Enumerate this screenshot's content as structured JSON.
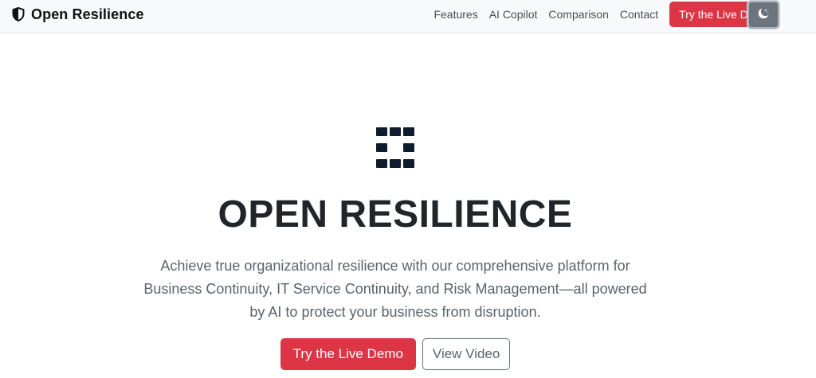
{
  "navbar": {
    "brand_icon": "shield-half-icon",
    "brand": "Open Resilience",
    "links": [
      {
        "label": "Features"
      },
      {
        "label": "AI Copilot"
      },
      {
        "label": "Comparison"
      },
      {
        "label": "Contact"
      }
    ],
    "cta_label": "Try the Live Demo",
    "theme_toggle_icon": "moon-stars-icon"
  },
  "hero": {
    "logo_icon": "grid-squares-logo",
    "title": "OPEN RESILIENCE",
    "description": "Achieve true organizational resilience with our comprehensive platform for Business Continuity, IT Service Continuity, and Risk Management—all powered by AI to protect your business from disruption.",
    "primary_button": "Try the Live Demo",
    "secondary_button": "View Video"
  },
  "colors": {
    "accent_red": "#dc3545",
    "navbar_bg": "#f8f9fa",
    "toggle_bg": "#6c757d",
    "text_dark": "#212529",
    "text_muted": "#5c636a"
  }
}
